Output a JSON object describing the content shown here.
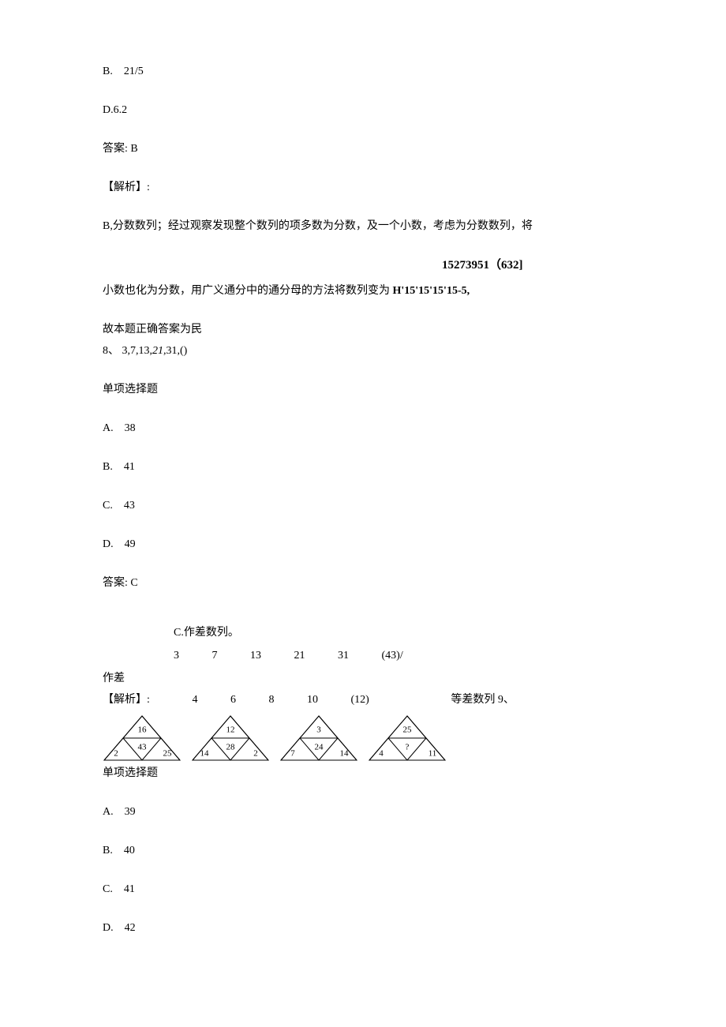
{
  "q7_partial": {
    "optB": "B.　21/5",
    "optD": "D.6.2",
    "answer": "答案: B",
    "analysis_label": "【解析】:",
    "analysis_line1": "B,分数数列；经过观察发现整个数列的项多数为分数，及一个小数，考虑为分数数列，将",
    "right_formula": "15273951（632]",
    "analysis_line2_a": "小数也化为分数，用广义通分中的通分母的方法将数列变为 ",
    "analysis_line2_b": "H'15'15'15'15-5,",
    "analysis_line3": "故本题正确答案为民"
  },
  "q8": {
    "stem_a": "8、 3,7,13,",
    "stem_italic": "21,",
    "stem_b": "31,()",
    "type": "单项选择题",
    "optA": "A.　38",
    "optB": "B.　41",
    "optC": "C.　43",
    "optD": "D.　49",
    "answer": "答案: C",
    "sol_c": "C.作差数列。",
    "seq": [
      "3",
      "7",
      "13",
      "21",
      "31",
      "(43)/"
    ],
    "diff_pre": "作差",
    "analysis_label": "【解析】:",
    "diffs": [
      "4",
      "6",
      "8",
      "10",
      "(12)"
    ],
    "diff_tail": "等差数列 9、"
  },
  "q9": {
    "triangles": [
      {
        "top": "16",
        "mid": "43",
        "left": "2",
        "right": "25"
      },
      {
        "top": "12",
        "mid": "28",
        "left": "14",
        "right": "2"
      },
      {
        "top": "3",
        "mid": "24",
        "left": "7",
        "right": "14"
      },
      {
        "top": "25",
        "mid": "?",
        "left": "4",
        "right": "11"
      }
    ],
    "type": "单项选择题",
    "optA": "A.　39",
    "optB": "B.　40",
    "optC": "C.　41",
    "optD": "D.　42"
  }
}
